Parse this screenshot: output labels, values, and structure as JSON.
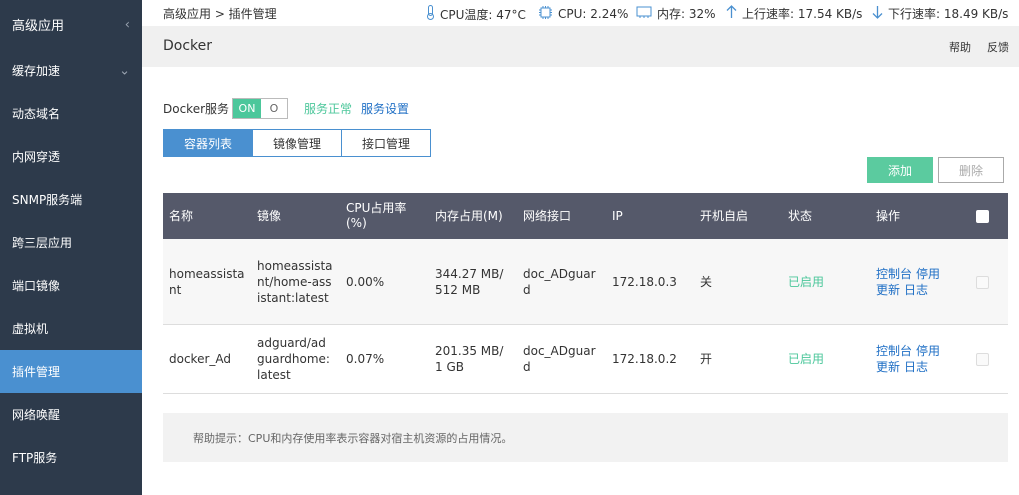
{
  "sidebar": {
    "items": [
      {
        "label": "高级应用",
        "chevron": "‹"
      },
      {
        "label": "缓存加速",
        "chevron": "⌄"
      },
      {
        "label": "动态域名"
      },
      {
        "label": "内网穿透"
      },
      {
        "label": "SNMP服务端"
      },
      {
        "label": "跨三层应用"
      },
      {
        "label": "端口镜像"
      },
      {
        "label": "虚拟机"
      },
      {
        "label": "插件管理",
        "active": true
      },
      {
        "label": "网络唤醒"
      },
      {
        "label": "FTP服务"
      }
    ]
  },
  "topbar": {
    "breadcrumb": "高级应用 > 插件管理",
    "cpu_temp": "CPU温度: 47°C",
    "cpu": "CPU: 2.24%",
    "mem": "内存: 32%",
    "up": "上行速率: 17.54 KB/s",
    "down": "下行速率: 18.49 KB/s",
    "icons": {
      "temp": "thermometer-icon",
      "cpu": "cpu-chip-icon",
      "mem": "memory-icon",
      "up": "arrow-up-icon",
      "down": "arrow-down-icon"
    }
  },
  "title_band": {
    "title": "Docker",
    "help": "帮助",
    "feedback": "反馈"
  },
  "service": {
    "label": "Docker服务",
    "toggle_on": "ON",
    "toggle_off": "O",
    "status": "服务正常",
    "settings": "服务设置"
  },
  "tabs": [
    {
      "label": "容器列表",
      "active": true
    },
    {
      "label": "镜像管理"
    },
    {
      "label": "接口管理"
    }
  ],
  "buttons": {
    "add": "添加",
    "delete": "删除"
  },
  "table": {
    "headers": [
      "名称",
      "镜像",
      "CPU占用率(%)",
      "内存占用(M)",
      "网络接口",
      "IP",
      "开机自启",
      "状态",
      "操作"
    ],
    "rows": [
      {
        "name": "homeassistant",
        "image": "homeassistant/home-assistant:latest",
        "cpu": "0.00%",
        "mem": "344.27 MB/512 MB",
        "iface": "doc_ADguard",
        "ip": "172.18.0.3",
        "autostart": "关",
        "status": "已启用",
        "ops": [
          "控制台",
          "停用",
          "更新",
          "日志"
        ]
      },
      {
        "name": "docker_Ad",
        "image": "adguard/adguardhome:latest",
        "cpu": "0.07%",
        "mem": "201.35 MB/1 GB",
        "iface": "doc_ADguard",
        "ip": "172.18.0.2",
        "autostart": "开",
        "status": "已启用",
        "ops": [
          "控制台",
          "停用",
          "更新",
          "日志"
        ]
      }
    ]
  },
  "help_text": "帮助提示：CPU和内存使用率表示容器对宿主机资源的占用情况。",
  "colors": {
    "sidebar_bg": "#2d3a4b",
    "accent": "#4a90d0",
    "success": "#4cc79b",
    "link": "#1f6fc5",
    "table_header": "#55596a"
  }
}
